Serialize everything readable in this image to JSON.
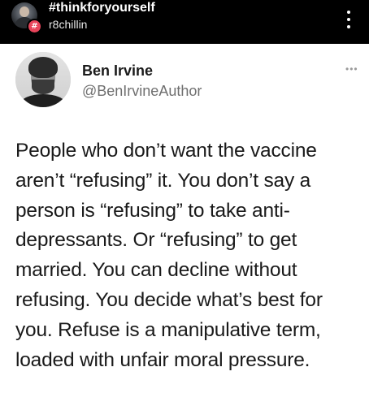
{
  "header": {
    "title": "#thinkforyourself",
    "subtitle": "r8chillin",
    "badge": "#",
    "avatar_icon": "profile-photo",
    "more_icon": "more-vertical-icon"
  },
  "tweet": {
    "author_name": "Ben Irvine",
    "author_handle": "@BenIrvineAuthor",
    "more_label": "•••",
    "body_lines": [
      "People who don’t want the vaccine",
      "aren’t “refusing” it. You don’t say a",
      "person is “refusing” to take anti-",
      "depressants. Or “refusing” to get",
      "married. You can decline without",
      "refusing. You decide what’s best for",
      "you. Refuse is a manipulative term,",
      "loaded with unfair moral pressure."
    ]
  },
  "colors": {
    "header_bg": "#000000",
    "badge": "#e8445a",
    "card_bg": "#ffffff",
    "text": "#1a1a1a",
    "handle": "#6f6f6f"
  }
}
